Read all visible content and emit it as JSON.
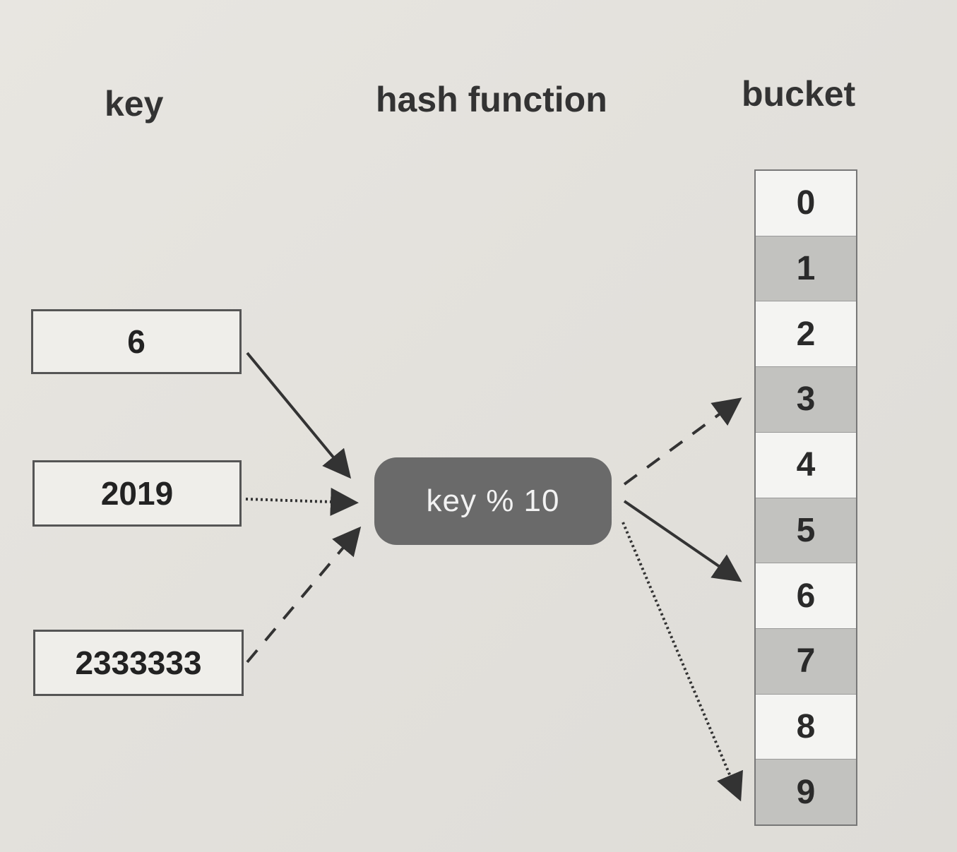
{
  "headers": {
    "key": "key",
    "hash_function": "hash function",
    "bucket": "bucket"
  },
  "keys": [
    "6",
    "2019",
    "2333333"
  ],
  "hash_function": {
    "label": "key % 10"
  },
  "buckets": [
    "0",
    "1",
    "2",
    "3",
    "4",
    "5",
    "6",
    "7",
    "8",
    "9"
  ],
  "mappings": [
    {
      "key": "6",
      "bucket": "6",
      "line_style": "solid"
    },
    {
      "key": "2019",
      "bucket": "9",
      "line_style": "dotted"
    },
    {
      "key": "2333333",
      "bucket": "3",
      "line_style": "dashed"
    }
  ]
}
